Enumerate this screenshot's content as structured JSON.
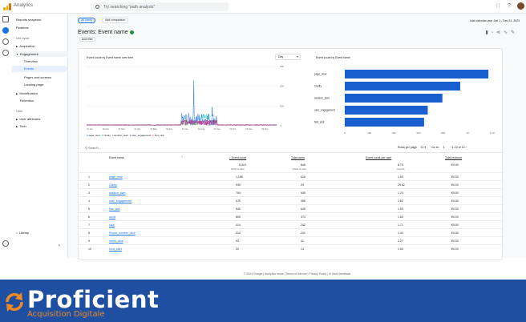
{
  "topbar": {
    "app_title": "Analytics",
    "search_placeholder": "Try searching \"path analysis\""
  },
  "sidebar": {
    "items": [
      {
        "label": "Reports snapshot"
      },
      {
        "label": "Realtime"
      },
      {
        "label": "Life cycle"
      },
      {
        "label": "Acquisition"
      },
      {
        "label": "Engagement"
      },
      {
        "label": "Overview"
      },
      {
        "label": "Events"
      },
      {
        "label": "Pages and screens"
      },
      {
        "label": "Landing page"
      },
      {
        "label": "Monetization"
      },
      {
        "label": "Retention"
      },
      {
        "label": "User"
      },
      {
        "label": "User attributes"
      },
      {
        "label": "Tech"
      }
    ],
    "library": "Library"
  },
  "main": {
    "chip_all_users": "All Users",
    "chip_add_comparison": "Add comparison",
    "date_range": "Last calendar year  Jan 1 - Dec 31, 2023",
    "title": "Events: Event name",
    "filter": "Add filter",
    "chart_left_title": "Event count by Event name over time",
    "chart_left_dropdown": "Day",
    "chart_right_title": "Event count by Event name",
    "legend": [
      "page_view",
      "Clarity",
      "session_start",
      "user_engagement",
      "first_visit"
    ],
    "search": "Search...",
    "rows_per_page_label": "Rows per page:",
    "rows_per_page": "10",
    "goto_label": "Go to:",
    "goto_value": "1",
    "pagination": "1-10 of 10"
  },
  "table": {
    "headers": [
      "Event name",
      "Event count",
      "Total users",
      "Event count per user",
      "Total revenue"
    ],
    "totals": {
      "event_count": "5,419",
      "event_count_sub": "100% of total",
      "total_users": "846",
      "total_users_sub": "100% of total",
      "per_user": "8.70",
      "per_user_sub": "Avg 0%",
      "revenue": "€0.00"
    },
    "rows": [
      {
        "n": "1",
        "name": "page_view",
        "count": "1,168",
        "users": "616",
        "per_user": "1.90",
        "rev": "€0.00"
      },
      {
        "n": "2",
        "name": "Clarity",
        "count": "939",
        "users": "29",
        "per_user": "29.62",
        "rev": "€0.00"
      },
      {
        "n": "3",
        "name": "session_start",
        "count": "794",
        "users": "645",
        "per_user": "1.23",
        "rev": "€0.00"
      },
      {
        "n": "4",
        "name": "user_engagement",
        "count": "675",
        "users": "368",
        "per_user": "1.82",
        "rev": "€0.00"
      },
      {
        "n": "5",
        "name": "first_visit",
        "count": "645",
        "users": "645",
        "per_user": "1.00",
        "rev": "€0.00"
      },
      {
        "n": "6",
        "name": "scroll",
        "count": "605",
        "users": "374",
        "per_user": "1.60",
        "rev": "€0.00"
      },
      {
        "n": "7",
        "name": "click",
        "count": "414",
        "users": "242",
        "per_user": "1.71",
        "rev": "€0.00"
      },
      {
        "n": "8",
        "name": "Phone_number_click",
        "count": "314",
        "users": "221",
        "per_user": "1.44",
        "rev": "€0.00"
      },
      {
        "n": "9",
        "name": "menu_click",
        "count": "93",
        "users": "41",
        "per_user": "2.27",
        "rev": "€0.00"
      },
      {
        "n": "10",
        "name": "form_start",
        "count": "20",
        "users": "13",
        "per_user": "1.54",
        "rev": "€0.00"
      }
    ]
  },
  "bar_chart": {
    "type": "bar",
    "categories": [
      "page_view",
      "Clarity",
      "session_start",
      "user_engagement",
      "first_visit"
    ],
    "values": [
      1168,
      939,
      794,
      675,
      645
    ],
    "xlim": [
      0,
      1200
    ],
    "xticks": [
      "0",
      "200",
      "400",
      "600",
      "800",
      "1K",
      "1.2K"
    ]
  },
  "line_chart": {
    "yticks": [
      "300",
      "200",
      "100",
      "0"
    ],
    "ylim": [
      0,
      300
    ],
    "xticks": [
      "01 Jan",
      "01 Feb",
      "01 Mar",
      "01 Apr",
      "01 May",
      "01 Jun",
      "01 Jul",
      "01 Aug",
      "01 Sep",
      "01 Oct",
      "01 Nov",
      "01 Dec"
    ]
  },
  "footer": "© 2024 Google | Analytics home | Terms of Service | Privacy Policy | ✉ Send feedback",
  "banner": {
    "brand": "Proficient",
    "tagline": "Acquisition Digitale"
  },
  "colors": {
    "accent": "#1a73e8",
    "banner": "#1e4fa0",
    "orange": "#f08a24"
  }
}
